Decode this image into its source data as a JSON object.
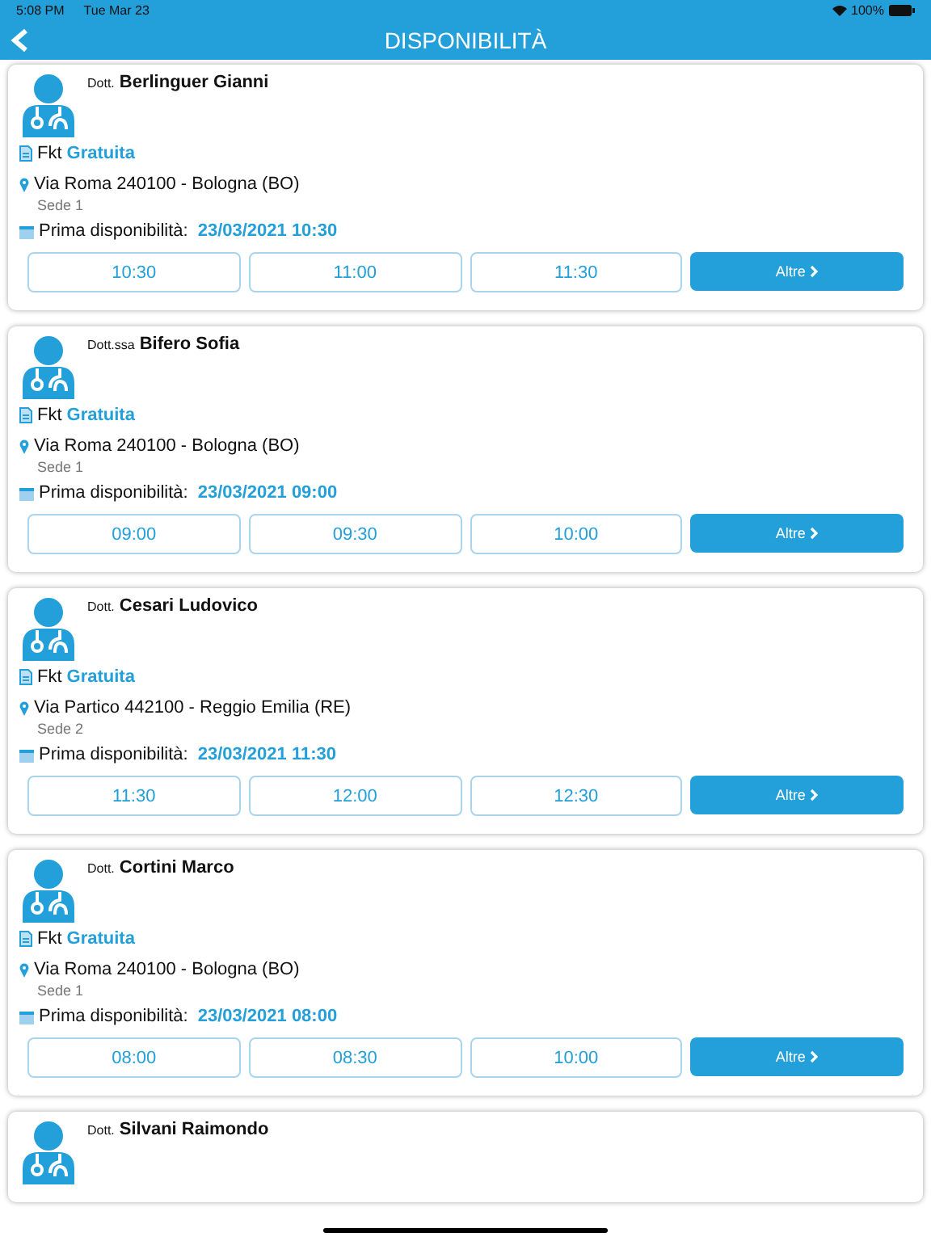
{
  "status_bar": {
    "time": "5:08 PM",
    "date": "Tue Mar 23",
    "battery": "100%"
  },
  "nav": {
    "title": "DISPONIBILITÀ"
  },
  "doctors": [
    {
      "prefix": "Dott.",
      "name": "Berlinguer Gianni",
      "service": "Fkt",
      "price": "Gratuita",
      "address": "Via Roma 240100 - Bologna (BO)",
      "site": "Sede 1",
      "first_label": "Prima disponibilità:",
      "first_value": "23/03/2021 10:30",
      "slots": [
        "10:30",
        "11:00",
        "11:30"
      ],
      "more": "Altre"
    },
    {
      "prefix": "Dott.ssa",
      "name": "Bifero Sofia",
      "service": "Fkt",
      "price": "Gratuita",
      "address": "Via Roma 240100 - Bologna (BO)",
      "site": "Sede 1",
      "first_label": "Prima disponibilità:",
      "first_value": "23/03/2021 09:00",
      "slots": [
        "09:00",
        "09:30",
        "10:00"
      ],
      "more": "Altre"
    },
    {
      "prefix": "Dott.",
      "name": "Cesari Ludovico",
      "service": "Fkt",
      "price": "Gratuita",
      "address": "Via Partico 442100 - Reggio Emilia (RE)",
      "site": "Sede 2",
      "first_label": "Prima disponibilità:",
      "first_value": "23/03/2021 11:30",
      "slots": [
        "11:30",
        "12:00",
        "12:30"
      ],
      "more": "Altre"
    },
    {
      "prefix": "Dott.",
      "name": "Cortini Marco",
      "service": "Fkt",
      "price": "Gratuita",
      "address": "Via Roma 240100 - Bologna (BO)",
      "site": "Sede 1",
      "first_label": "Prima disponibilità:",
      "first_value": "23/03/2021 08:00",
      "slots": [
        "08:00",
        "08:30",
        "10:00"
      ],
      "more": "Altre"
    },
    {
      "prefix": "Dott.",
      "name": "Silvani Raimondo"
    }
  ]
}
